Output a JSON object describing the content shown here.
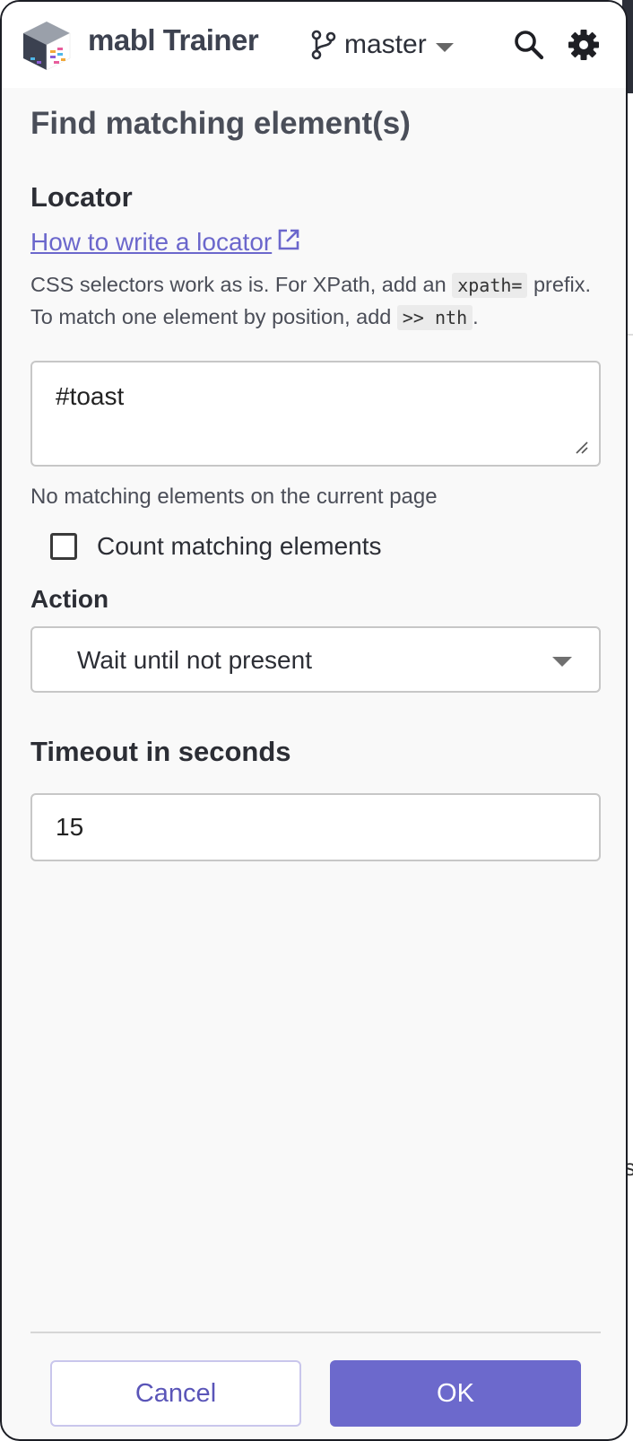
{
  "header": {
    "app_title": "mabl Trainer",
    "branch": "master",
    "logo_icon": "mabl-cube-logo",
    "branch_icon": "git-branch-icon",
    "search_icon": "search-icon",
    "settings_icon": "gear-icon"
  },
  "page": {
    "title": "Find matching element(s)"
  },
  "locator": {
    "section_label": "Locator",
    "help_link": "How to write a locator",
    "hint_part1": "CSS selectors work as is. For XPath, add an ",
    "hint_code1": "xpath=",
    "hint_part2": " prefix. To match one element by position, add ",
    "hint_code2": ">> nth",
    "hint_part3": ".",
    "value": "#toast",
    "match_status": "No matching elements on the current page"
  },
  "count_matching": {
    "label": "Count matching elements",
    "checked": false
  },
  "action": {
    "label": "Action",
    "selected": "Wait until not present"
  },
  "timeout": {
    "label": "Timeout in seconds",
    "value": "15"
  },
  "footer": {
    "cancel_label": "Cancel",
    "ok_label": "OK"
  },
  "colors": {
    "accent": "#6c69cc",
    "link": "#6b67cc",
    "text": "#2c2e35",
    "panel_background": "#f9f9f9"
  }
}
